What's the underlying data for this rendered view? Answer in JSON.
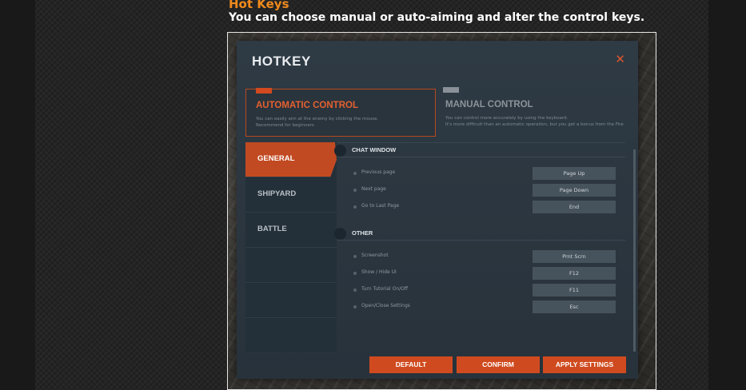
{
  "page": {
    "heading": "Hot Keys",
    "subheading": "You can choose manual or auto-aiming and alter the control keys."
  },
  "dialog": {
    "title": "HOTKEY",
    "close_icon": "close-icon",
    "modes": [
      {
        "title": "AUTOMATIC CONTROL",
        "desc1": "You can easily aim at the enemy by clicking the mouse.",
        "desc2": "Recommend for beginners",
        "selected": true
      },
      {
        "title": "MANUAL CONTROL",
        "desc1": "You can control more accurately by using the keyboard.",
        "desc2": "It's more difficult than an automatic operation, but you get a bonus from the Fire",
        "selected": false
      }
    ],
    "tabs": [
      {
        "label": "GENERAL",
        "active": true
      },
      {
        "label": "SHIPYARD",
        "active": false
      },
      {
        "label": "BATTLE",
        "active": false
      }
    ],
    "sections": [
      {
        "title": "CHAT WINDOW",
        "rows": [
          {
            "label": "Previous page",
            "key": "Page Up"
          },
          {
            "label": "Next page",
            "key": "Page Down"
          },
          {
            "label": "Go to Last Page",
            "key": "End"
          }
        ]
      },
      {
        "title": "OTHER",
        "rows": [
          {
            "label": "Screenshot",
            "key": "Prnt Scrn"
          },
          {
            "label": "Show / Hide UI",
            "key": "F12"
          },
          {
            "label": "Turn Tutorial On/Off",
            "key": "F11"
          },
          {
            "label": "Open/Close Settings",
            "key": "Esc"
          }
        ]
      }
    ],
    "buttons": {
      "default": "DEFAULT",
      "confirm": "CONFIRM",
      "apply": "APPLY SETTINGS"
    }
  },
  "colors": {
    "heading": "#f08a1c",
    "accent": "#cf4b1f",
    "dialog_bg": "#2e3a44"
  }
}
